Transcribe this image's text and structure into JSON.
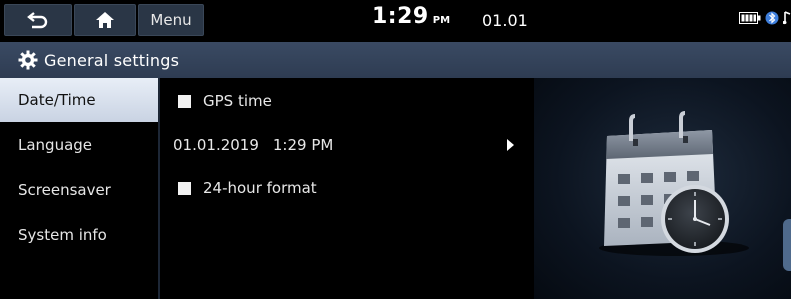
{
  "topbar": {
    "menu_label": "Menu",
    "time": "1:29",
    "ampm": "PM",
    "date": "01.01",
    "icons": [
      "back-icon",
      "home-icon",
      "battery-icon",
      "bluetooth-icon",
      "music-note-icon"
    ]
  },
  "header": {
    "title": "General settings",
    "icon": "gear-icon"
  },
  "sidebar": {
    "items": [
      {
        "label": "Date/Time",
        "active": true
      },
      {
        "label": "Language",
        "active": false
      },
      {
        "label": "Screensaver",
        "active": false
      },
      {
        "label": "System info",
        "active": false
      }
    ]
  },
  "content": {
    "gps_time": {
      "label": "GPS time",
      "checked": false
    },
    "datetime": {
      "date": "01.01.2019",
      "time": "1:29 PM"
    },
    "hour24": {
      "label": "24-hour format",
      "checked": false
    }
  },
  "colors": {
    "header_bg": "#34435a",
    "active_item_bg": "#dde4ef",
    "button_bg": "#2a3646"
  }
}
